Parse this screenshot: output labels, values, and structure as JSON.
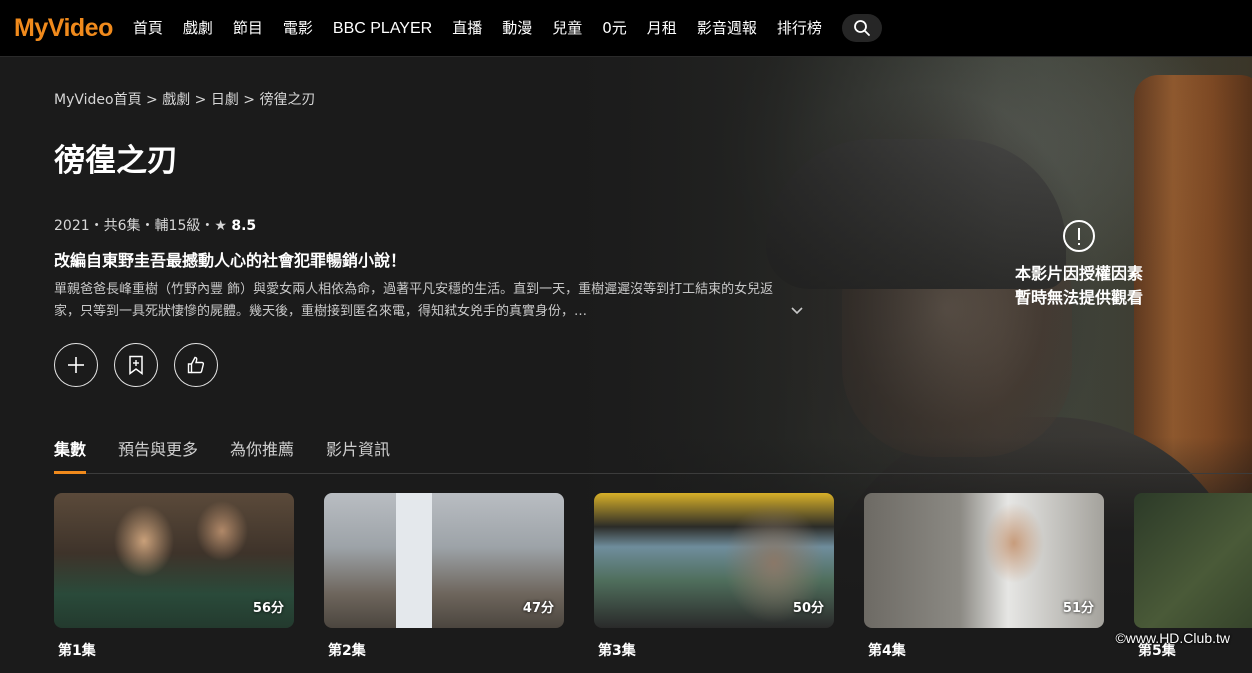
{
  "header": {
    "logo": "MyVideo",
    "nav": [
      "首頁",
      "戲劇",
      "節目",
      "電影",
      "BBC PLAYER",
      "直播",
      "動漫",
      "兒童",
      "0元",
      "月租",
      "影音週報",
      "排行榜"
    ],
    "search_icon": "search-icon"
  },
  "breadcrumb": "MyVideo首頁 > 戲劇 > 日劇 > 徬徨之刃",
  "title": "徬徨之刃",
  "meta": {
    "info": "2021・共6集・輔15級・",
    "star": "★",
    "rating": "8.5"
  },
  "tagline": "改編自東野圭吾最撼動人心的社會犯罪暢銷小說！",
  "synopsis": "單親爸爸長峰重樹（竹野內豐 飾）與愛女兩人相依為命，過著平凡安穩的生活。直到一天，重樹遲遲沒等到打工結束的女兒返家，只等到一具死狀悽慘的屍體。幾天後，重樹接到匿名來電，得知弒女兇手的真實身份，…",
  "expand_icon": "chevron-down-icon",
  "actions": [
    "plus-icon",
    "bookmark-icon",
    "thumbs-up-icon"
  ],
  "notice": {
    "line1": "本影片因授權因素",
    "line2": "暫時無法提供觀看"
  },
  "tabs": [
    "集數",
    "預告與更多",
    "為你推薦",
    "影片資訊"
  ],
  "episodes": [
    {
      "label": "第1集",
      "duration": "56分"
    },
    {
      "label": "第2集",
      "duration": "47分"
    },
    {
      "label": "第3集",
      "duration": "50分"
    },
    {
      "label": "第4集",
      "duration": "51分"
    },
    {
      "label": "第5集",
      "duration": ""
    }
  ],
  "watermark": "©www.HD.Club.tw",
  "colors": {
    "accent": "#f08a1c",
    "background": "#1b1b1b",
    "topbar": "#000000"
  }
}
